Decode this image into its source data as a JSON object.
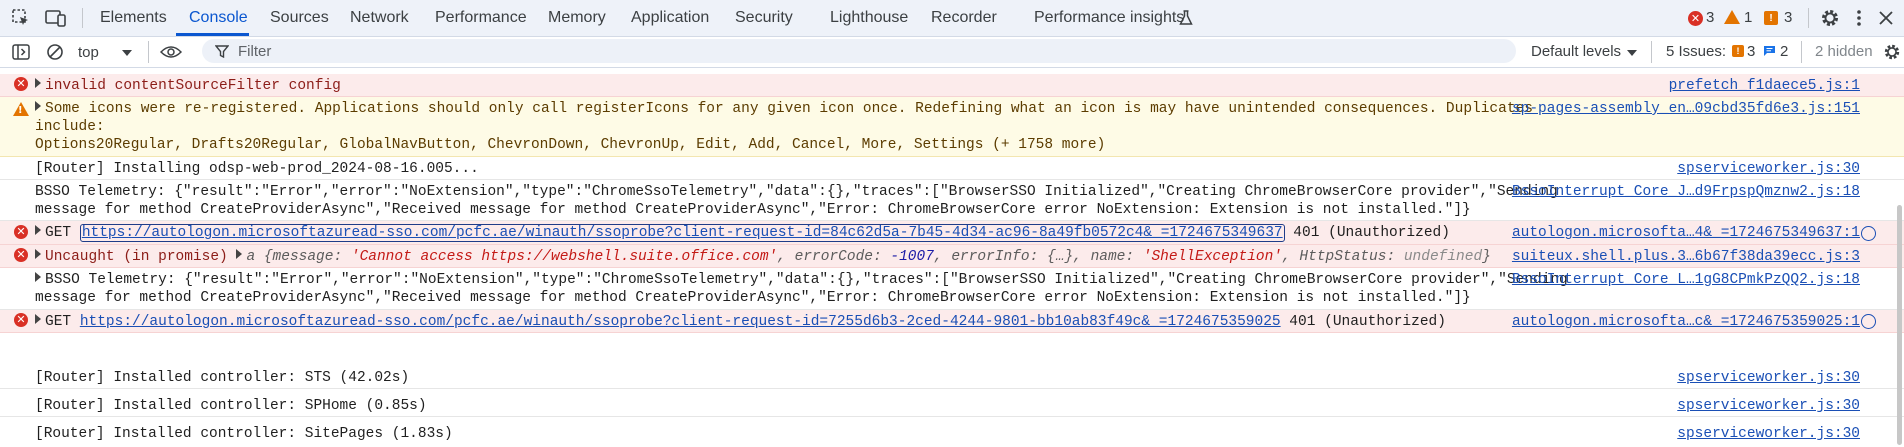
{
  "tabs": [
    "Elements",
    "Console",
    "Sources",
    "Network",
    "Performance",
    "Memory",
    "Application",
    "Security",
    "Lighthouse",
    "Recorder",
    "Performance insights"
  ],
  "active_tab": "Console",
  "counts": {
    "errors": "3",
    "warnings": "1",
    "issues": "3"
  },
  "filterbar": {
    "context": "top",
    "filter_placeholder": "Filter",
    "levels": "Default levels",
    "issues_label": "5 Issues:",
    "issues_warn": "3",
    "issues_info": "2",
    "hidden": "2 hidden"
  },
  "rows": [
    {
      "type": "error",
      "text": "invalid contentSourceFilter config",
      "source": "prefetch_f1daece5.js:1"
    },
    {
      "type": "warning",
      "line1": "Some icons were re-registered. Applications should only call registerIcons for any given icon once. Redefining what an icon is may have unintended consequences. Duplicates",
      "line2": "include:",
      "line3": "Options20Regular, Drafts20Regular, GlobalNavButton, ChevronDown, ChevronUp, Edit, Add, Cancel, More, Settings (+ 1758 more)",
      "source": "sp-pages-assembly_en…09cbd35fd6e3.js:151"
    },
    {
      "type": "log",
      "text": "[Router] Installing odsp-web-prod_2024-08-16.005...",
      "source": "spserviceworker.js:30"
    },
    {
      "type": "log",
      "line1": "BSSO Telemetry: {\"result\":\"Error\",\"error\":\"NoExtension\",\"type\":\"ChromeSsoTelemetry\",\"data\":{},\"traces\":[\"BrowserSSO Initialized\",\"Creating ChromeBrowserCore provider\",\"Sending",
      "line2": "message for method CreateProviderAsync\",\"Received message for method CreateProviderAsync\",\"Error: ChromeBrowserCore error NoExtension: Extension is not installed.\"]}",
      "source": "BssoInterrupt_Core_J…d9FrpspQmznw2.js:18"
    },
    {
      "type": "error",
      "prefix": "GET ",
      "url": "https://autologon.microsoftazuread-sso.com/pcfc.ae/winauth/ssoprobe?client-request-id=84c62d5a-7b45-4d34-ac96-8a49fb0572c4&_=1724675349637",
      "suffix": " 401 (Unauthorized)",
      "source": "autologon.microsofta…4&_=1724675349637:1"
    },
    {
      "type": "error",
      "prefix": "Uncaught (in promise) ",
      "obj_label": "a",
      "k1": "message",
      "v1": "'Cannot access https://webshell.suite.office.com'",
      "k2": "errorCode",
      "v2": "-1007",
      "k3": "errorInfo",
      "v3": "{…}",
      "k4": "name",
      "v4": "'ShellException'",
      "k5": "HttpStatus",
      "v5": "undefined",
      "source": "suiteux.shell.plus.3…6b67f38da39ecc.js:3"
    },
    {
      "type": "log",
      "line1": "BSSO Telemetry: {\"result\":\"Error\",\"error\":\"NoExtension\",\"type\":\"ChromeSsoTelemetry\",\"data\":{},\"traces\":[\"BrowserSSO Initialized\",\"Creating ChromeBrowserCore provider\",\"Sending",
      "line2": "message for method CreateProviderAsync\",\"Received message for method CreateProviderAsync\",\"Error: ChromeBrowserCore error NoExtension: Extension is not installed.\"]}",
      "source": "BssoInterrupt_Core_L…1gG8CPmkPzQQ2.js:18"
    },
    {
      "type": "error",
      "prefix": "GET ",
      "url": "https://autologon.microsoftazuread-sso.com/pcfc.ae/winauth/ssoprobe?client-request-id=7255d6b3-2ced-4244-9801-bb10ab83f49c&_=1724675359025",
      "suffix": " 401 (Unauthorized)",
      "source": "autologon.microsofta…c&_=1724675359025:1"
    },
    {
      "type": "log",
      "text": "[Router] Installed controller: STS (42.02s)",
      "source": "spserviceworker.js:30"
    },
    {
      "type": "log",
      "text": "[Router] Installed controller: SPHome (0.85s)",
      "source": "spserviceworker.js:30"
    },
    {
      "type": "log",
      "text": "[Router] Installed controller: SitePages (1.83s)",
      "source": "spserviceworker.js:30"
    }
  ]
}
